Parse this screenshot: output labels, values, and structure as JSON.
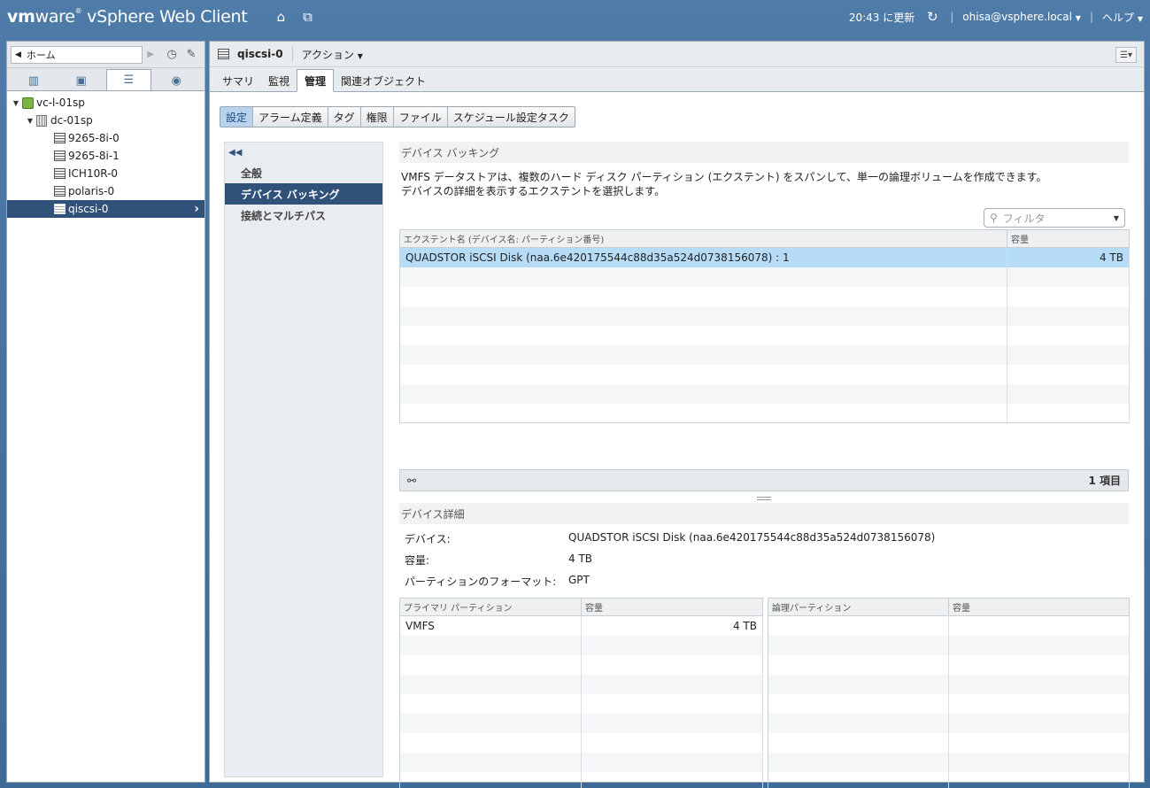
{
  "app": {
    "brand_vm": "vm",
    "brand_ware": "ware",
    "brand_rest": "vSphere Web Client",
    "updated": "20:43 に更新",
    "user": "ohisa@vsphere.local",
    "help": "ヘルプ"
  },
  "nav": {
    "home": "ホーム",
    "tree": [
      {
        "label": "vc-l-01sp",
        "icon": "vcenter-icon"
      },
      {
        "label": "dc-01sp",
        "icon": "datacenter-icon"
      },
      {
        "label": "9265-8i-0",
        "icon": "datastore-icon"
      },
      {
        "label": "9265-8i-1",
        "icon": "datastore-icon"
      },
      {
        "label": "ICH10R-0",
        "icon": "datastore-icon"
      },
      {
        "label": "polaris-0",
        "icon": "datastore-icon"
      },
      {
        "label": "qiscsi-0",
        "icon": "datastore-icon",
        "selected": true
      }
    ]
  },
  "object": {
    "title": "qiscsi-0",
    "actions": "アクション"
  },
  "tabs": [
    "サマリ",
    "監視",
    "管理",
    "関連オブジェクト"
  ],
  "subtabs": [
    "設定",
    "アラーム定義",
    "タグ",
    "権限",
    "ファイル",
    "スケジュール設定タスク"
  ],
  "settings_nav": [
    "全般",
    "デバイス バッキング",
    "接続とマルチパス"
  ],
  "backing": {
    "title": "デバイス バッキング",
    "desc1": "VMFS データストアは、複数のハード ディスク パーティション (エクステント) をスパンして、単一の論理ボリュームを作成できます。",
    "desc2": "デバイスの詳細を表示するエクステントを選択します。",
    "filter_placeholder": "フィルタ",
    "col_extent": "エクステント名 (デバイス名: パーティション番号)",
    "col_capacity": "容量",
    "rows": [
      {
        "name": "QUADSTOR iSCSI Disk (naa.6e420175544c88d35a524d0738156078) : 1",
        "capacity": "4 TB"
      }
    ],
    "count": "1 項目"
  },
  "details": {
    "title": "デバイス詳細",
    "device_label": "デバイス:",
    "device_value": "QUADSTOR iSCSI Disk (naa.6e420175544c88d35a524d0738156078)",
    "capacity_label": "容量:",
    "capacity_value": "4 TB",
    "format_label": "パーティションのフォーマット:",
    "format_value": "GPT",
    "primary_col": "プライマリ パーティション",
    "primary_cap_col": "容量",
    "primary_rows": [
      {
        "name": "VMFS",
        "capacity": "4 TB"
      }
    ],
    "logical_col": "論理パーティション",
    "logical_cap_col": "容量"
  }
}
